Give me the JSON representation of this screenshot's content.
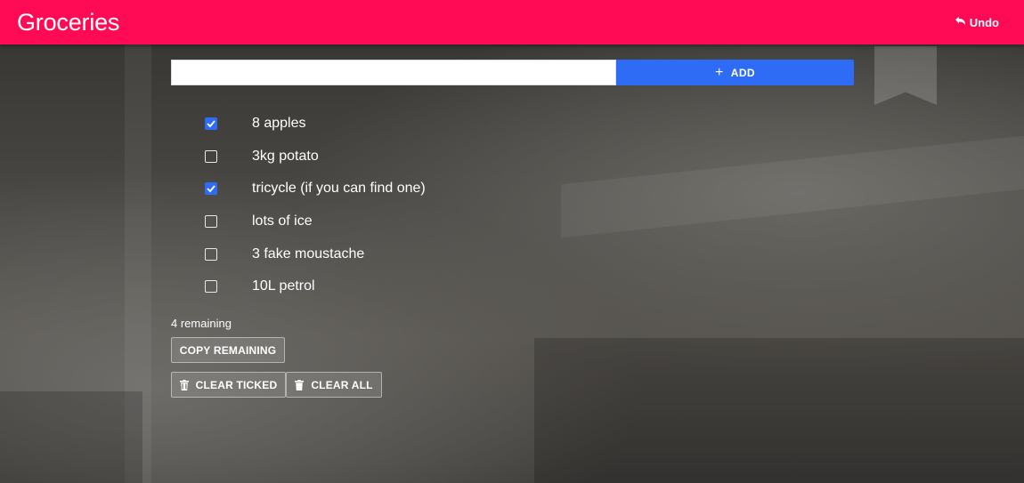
{
  "app": {
    "title": "Groceries",
    "undo_label": "Undo"
  },
  "add": {
    "input_value": "",
    "button_label": "ADD"
  },
  "items": [
    {
      "label": "8 apples",
      "checked": true
    },
    {
      "label": "3kg potato",
      "checked": false
    },
    {
      "label": "tricycle (if you can find one)",
      "checked": true
    },
    {
      "label": "lots of ice",
      "checked": false
    },
    {
      "label": "3 fake moustache",
      "checked": false
    },
    {
      "label": "10L petrol",
      "checked": false
    }
  ],
  "remaining_text": "4 remaining",
  "buttons": {
    "copy_remaining": "COPY REMAINING",
    "clear_ticked": "CLEAR TICKED",
    "clear_all": "CLEAR ALL"
  },
  "colors": {
    "header": "#ff0a54",
    "accent": "#2f6cf6"
  },
  "icons": {
    "undo": "undo-icon",
    "add": "plus-icon",
    "trash": "trash-icon",
    "check": "check-icon"
  }
}
